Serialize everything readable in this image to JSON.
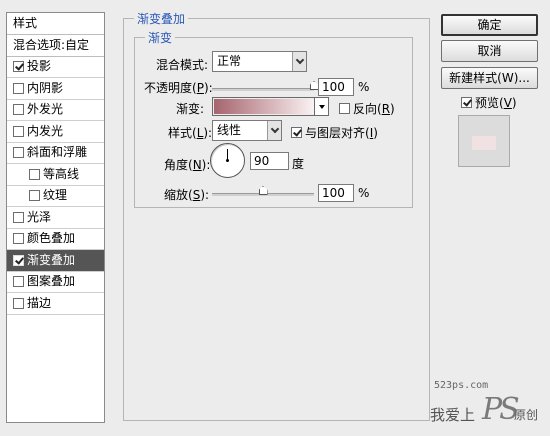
{
  "left_panel": {
    "header": "样式",
    "blend_options": "混合选项:自定",
    "items": [
      {
        "label": "投影",
        "checked": true,
        "indent": false,
        "selected": false
      },
      {
        "label": "内阴影",
        "checked": false,
        "indent": false,
        "selected": false
      },
      {
        "label": "外发光",
        "checked": false,
        "indent": false,
        "selected": false
      },
      {
        "label": "内发光",
        "checked": false,
        "indent": false,
        "selected": false
      },
      {
        "label": "斜面和浮雕",
        "checked": false,
        "indent": false,
        "selected": false
      },
      {
        "label": "等高线",
        "checked": false,
        "indent": true,
        "selected": false
      },
      {
        "label": "纹理",
        "checked": false,
        "indent": true,
        "selected": false
      },
      {
        "label": "光泽",
        "checked": false,
        "indent": false,
        "selected": false
      },
      {
        "label": "颜色叠加",
        "checked": false,
        "indent": false,
        "selected": false
      },
      {
        "label": "渐变叠加",
        "checked": true,
        "indent": false,
        "selected": true
      },
      {
        "label": "图案叠加",
        "checked": false,
        "indent": false,
        "selected": false
      },
      {
        "label": "描边",
        "checked": false,
        "indent": false,
        "selected": false
      }
    ]
  },
  "gradient_overlay": {
    "group_title": "渐变叠加",
    "sub_title": "渐变",
    "blend_mode_label": "混合模式:",
    "blend_mode_value": "正常",
    "opacity_label": "不透明度(",
    "opacity_key": "P",
    "opacity_label_end": "):",
    "opacity_value": "100",
    "opacity_unit": "%",
    "opacity_level": 1.0,
    "gradient_label": "渐变:",
    "gradient_colors": [
      "#a6646e",
      "#fbf2f3"
    ],
    "reverse_label": "反向(",
    "reverse_key": "R",
    "reverse_label_end": ")",
    "reverse_checked": false,
    "style_label": "样式(",
    "style_key": "L",
    "style_label_end": "):",
    "style_value": "线性",
    "align_label": "与图层对齐(",
    "align_key": "I",
    "align_label_end": ")",
    "align_checked": true,
    "angle_label": "角度(",
    "angle_key": "N",
    "angle_label_end": "):",
    "angle_value": "90",
    "angle_unit": "度",
    "scale_label": "缩放(",
    "scale_key": "S",
    "scale_label_end": "):",
    "scale_value": "100",
    "scale_unit": "%",
    "scale_level": 0.5
  },
  "buttons": {
    "ok": "确定",
    "cancel": "取消",
    "new_style": "新建样式(W)...",
    "preview_label": "预览(",
    "preview_key": "V",
    "preview_label_end": ")",
    "preview_checked": true
  },
  "watermark": {
    "site": "523ps.com",
    "text_left": "我爱上",
    "text_ps": "PS",
    "text_right": "原创"
  }
}
